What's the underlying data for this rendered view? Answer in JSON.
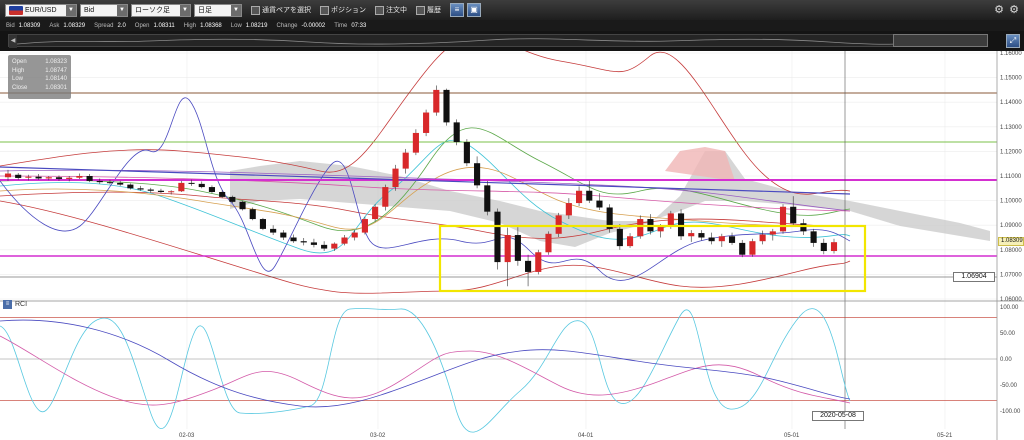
{
  "toolbar": {
    "symbol": "EUR/USD",
    "price_side": "Bid",
    "chart_type": "ローソク足",
    "timeframe": "日足",
    "checkbox_pair": "通貨ペアを選択",
    "checkbox_position": "ポジション",
    "checkbox_order": "注文中",
    "checkbox_history": "履歴"
  },
  "info": {
    "bid_label": "Bid",
    "bid": "1.08309",
    "ask_label": "Ask",
    "ask": "1.08329",
    "spread_label": "Spread",
    "spread": "2.0",
    "open_label": "Open",
    "open": "1.08311",
    "high_label": "High",
    "high": "1.08368",
    "low_label": "Low",
    "low": "1.08219",
    "change_label": "Change",
    "change": "-0.00002",
    "time_label": "Time",
    "time": "07:33"
  },
  "ohlc_box": {
    "open_label": "Open",
    "open": "1.08323",
    "high_label": "High",
    "high": "1.08747",
    "low_label": "Low",
    "low": "1.08140",
    "close_label": "Close",
    "close": "1.08301"
  },
  "price_axis": [
    "1.16000",
    "1.15000",
    "1.14000",
    "1.13000",
    "1.12000",
    "1.11000",
    "1.10000",
    "1.09000",
    "1.08000",
    "1.07000",
    "1.06000"
  ],
  "current_price_tag": "1.08309",
  "level_tag": "1.06904",
  "rci_panel": {
    "label": "RCI",
    "axis": [
      "100.00",
      "50.00",
      "0.00",
      "-50.00",
      "-100.00"
    ]
  },
  "date_axis": [
    "02-03",
    "03-02",
    "04-01",
    "05-01",
    "05-21"
  ],
  "crosshair_date": "2020-05-08",
  "colors": {
    "highlight_box": "#f2e600",
    "resistance_magenta": "#d42fd0",
    "candle_up": "#d8282a",
    "candle_down": "#111111",
    "cloud": "#b5b5b5"
  },
  "chart_data": {
    "type": "candlestick",
    "description_series": [
      "candles",
      "bollinger bands",
      "ichimoku cloud",
      "moving averages",
      "RCI"
    ],
    "candles": [
      {
        "o": 1.1095,
        "h": 1.1125,
        "l": 1.108,
        "c": 1.111
      },
      {
        "o": 1.1105,
        "h": 1.1112,
        "l": 1.1085,
        "c": 1.1092
      },
      {
        "o": 1.1093,
        "h": 1.1105,
        "l": 1.1082,
        "c": 1.1097
      },
      {
        "o": 1.1097,
        "h": 1.1108,
        "l": 1.1085,
        "c": 1.109
      },
      {
        "o": 1.109,
        "h": 1.11,
        "l": 1.1083,
        "c": 1.1095
      },
      {
        "o": 1.1095,
        "h": 1.1102,
        "l": 1.108,
        "c": 1.1088
      },
      {
        "o": 1.1088,
        "h": 1.11,
        "l": 1.1078,
        "c": 1.1093
      },
      {
        "o": 1.1093,
        "h": 1.111,
        "l": 1.1088,
        "c": 1.11
      },
      {
        "o": 1.11,
        "h": 1.1108,
        "l": 1.1075,
        "c": 1.108
      },
      {
        "o": 1.108,
        "h": 1.109,
        "l": 1.1068,
        "c": 1.1075
      },
      {
        "o": 1.1075,
        "h": 1.1085,
        "l": 1.1066,
        "c": 1.1072
      },
      {
        "o": 1.1072,
        "h": 1.108,
        "l": 1.106,
        "c": 1.1065
      },
      {
        "o": 1.1065,
        "h": 1.107,
        "l": 1.1045,
        "c": 1.105
      },
      {
        "o": 1.105,
        "h": 1.106,
        "l": 1.104,
        "c": 1.1045
      },
      {
        "o": 1.1045,
        "h": 1.1052,
        "l": 1.1032,
        "c": 1.104
      },
      {
        "o": 1.104,
        "h": 1.1048,
        "l": 1.103,
        "c": 1.1035
      },
      {
        "o": 1.1035,
        "h": 1.1042,
        "l": 1.1025,
        "c": 1.1038
      },
      {
        "o": 1.1038,
        "h": 1.108,
        "l": 1.1035,
        "c": 1.1072
      },
      {
        "o": 1.1072,
        "h": 1.1085,
        "l": 1.106,
        "c": 1.1068
      },
      {
        "o": 1.1068,
        "h": 1.1078,
        "l": 1.105,
        "c": 1.1055
      },
      {
        "o": 1.1055,
        "h": 1.1062,
        "l": 1.103,
        "c": 1.1035
      },
      {
        "o": 1.1035,
        "h": 1.1042,
        "l": 1.101,
        "c": 1.1015
      },
      {
        "o": 1.1015,
        "h": 1.102,
        "l": 1.099,
        "c": 1.0995
      },
      {
        "o": 1.0995,
        "h": 1.1,
        "l": 1.096,
        "c": 1.0965
      },
      {
        "o": 1.0965,
        "h": 1.0972,
        "l": 1.092,
        "c": 1.0925
      },
      {
        "o": 1.0925,
        "h": 1.093,
        "l": 1.088,
        "c": 1.0885
      },
      {
        "o": 1.0885,
        "h": 1.09,
        "l": 1.086,
        "c": 1.087
      },
      {
        "o": 1.087,
        "h": 1.088,
        "l": 1.084,
        "c": 1.085
      },
      {
        "o": 1.085,
        "h": 1.0862,
        "l": 1.0828,
        "c": 1.0835
      },
      {
        "o": 1.0835,
        "h": 1.0848,
        "l": 1.0818,
        "c": 1.083
      },
      {
        "o": 1.083,
        "h": 1.0845,
        "l": 1.081,
        "c": 1.082
      },
      {
        "o": 1.082,
        "h": 1.0835,
        "l": 1.0795,
        "c": 1.0805
      },
      {
        "o": 1.0805,
        "h": 1.083,
        "l": 1.0795,
        "c": 1.0825
      },
      {
        "o": 1.0825,
        "h": 1.086,
        "l": 1.0818,
        "c": 1.085
      },
      {
        "o": 1.085,
        "h": 1.088,
        "l": 1.0838,
        "c": 1.087
      },
      {
        "o": 1.087,
        "h": 1.0935,
        "l": 1.0862,
        "c": 1.0925
      },
      {
        "o": 1.0925,
        "h": 1.0985,
        "l": 1.0915,
        "c": 1.0975
      },
      {
        "o": 1.0975,
        "h": 1.1065,
        "l": 1.096,
        "c": 1.1055
      },
      {
        "o": 1.1055,
        "h": 1.1145,
        "l": 1.104,
        "c": 1.113
      },
      {
        "o": 1.113,
        "h": 1.121,
        "l": 1.111,
        "c": 1.1195
      },
      {
        "o": 1.1195,
        "h": 1.129,
        "l": 1.1185,
        "c": 1.1275
      },
      {
        "o": 1.1275,
        "h": 1.137,
        "l": 1.1262,
        "c": 1.1358
      },
      {
        "o": 1.1358,
        "h": 1.1468,
        "l": 1.1345,
        "c": 1.145
      },
      {
        "o": 1.145,
        "h": 1.1455,
        "l": 1.1305,
        "c": 1.1318
      },
      {
        "o": 1.1318,
        "h": 1.133,
        "l": 1.1225,
        "c": 1.1238
      },
      {
        "o": 1.1238,
        "h": 1.125,
        "l": 1.114,
        "c": 1.1152
      },
      {
        "o": 1.1152,
        "h": 1.118,
        "l": 1.105,
        "c": 1.1062
      },
      {
        "o": 1.1062,
        "h": 1.108,
        "l": 1.094,
        "c": 1.0955
      },
      {
        "o": 1.0955,
        "h": 1.0968,
        "l": 1.072,
        "c": 1.075
      },
      {
        "o": 1.075,
        "h": 1.089,
        "l": 1.0652,
        "c": 1.086
      },
      {
        "o": 1.086,
        "h": 1.0892,
        "l": 1.0735,
        "c": 1.0755
      },
      {
        "o": 1.0755,
        "h": 1.078,
        "l": 1.0652,
        "c": 1.071
      },
      {
        "o": 1.071,
        "h": 1.08,
        "l": 1.07,
        "c": 1.079
      },
      {
        "o": 1.079,
        "h": 1.0875,
        "l": 1.078,
        "c": 1.0865
      },
      {
        "o": 1.0865,
        "h": 1.095,
        "l": 1.0852,
        "c": 1.094
      },
      {
        "o": 1.094,
        "h": 1.101,
        "l": 1.0925,
        "c": 1.099
      },
      {
        "o": 1.099,
        "h": 1.1058,
        "l": 1.0978,
        "c": 1.104
      },
      {
        "o": 1.104,
        "h": 1.108,
        "l": 1.099,
        "c": 1.1
      },
      {
        "o": 1.1,
        "h": 1.103,
        "l": 1.0962,
        "c": 1.0972
      },
      {
        "o": 1.0972,
        "h": 1.0985,
        "l": 1.087,
        "c": 1.0885
      },
      {
        "o": 1.0885,
        "h": 1.0905,
        "l": 1.08,
        "c": 1.0815
      },
      {
        "o": 1.0815,
        "h": 1.0868,
        "l": 1.0808,
        "c": 1.0855
      },
      {
        "o": 1.0855,
        "h": 1.094,
        "l": 1.0845,
        "c": 1.0925
      },
      {
        "o": 1.0925,
        "h": 1.0945,
        "l": 1.0862,
        "c": 1.0875
      },
      {
        "o": 1.0875,
        "h": 1.0905,
        "l": 1.085,
        "c": 1.0895
      },
      {
        "o": 1.0895,
        "h": 1.0958,
        "l": 1.0885,
        "c": 1.0948
      },
      {
        "o": 1.0948,
        "h": 1.0965,
        "l": 1.084,
        "c": 1.0855
      },
      {
        "o": 1.0855,
        "h": 1.088,
        "l": 1.0832,
        "c": 1.0868
      },
      {
        "o": 1.0868,
        "h": 1.088,
        "l": 1.0838,
        "c": 1.085
      },
      {
        "o": 1.085,
        "h": 1.087,
        "l": 1.0822,
        "c": 1.0835
      },
      {
        "o": 1.0835,
        "h": 1.0865,
        "l": 1.0812,
        "c": 1.0855
      },
      {
        "o": 1.0855,
        "h": 1.087,
        "l": 1.082,
        "c": 1.0828
      },
      {
        "o": 1.0828,
        "h": 1.084,
        "l": 1.077,
        "c": 1.078
      },
      {
        "o": 1.078,
        "h": 1.0845,
        "l": 1.0772,
        "c": 1.0835
      },
      {
        "o": 1.0835,
        "h": 1.0878,
        "l": 1.0822,
        "c": 1.0862
      },
      {
        "o": 1.0862,
        "h": 1.0885,
        "l": 1.0838,
        "c": 1.0875
      },
      {
        "o": 1.0875,
        "h": 1.0985,
        "l": 1.0865,
        "c": 1.0975
      },
      {
        "o": 1.0975,
        "h": 1.1018,
        "l": 1.0895,
        "c": 1.0908
      },
      {
        "o": 1.0908,
        "h": 1.0925,
        "l": 1.086,
        "c": 1.0875
      },
      {
        "o": 1.0875,
        "h": 1.0885,
        "l": 1.0812,
        "c": 1.0828
      },
      {
        "o": 1.0828,
        "h": 1.0845,
        "l": 1.0782,
        "c": 1.0795
      },
      {
        "o": 1.0795,
        "h": 1.0845,
        "l": 1.0785,
        "c": 1.0831
      }
    ]
  }
}
